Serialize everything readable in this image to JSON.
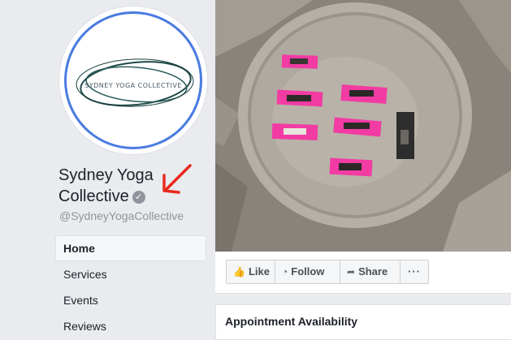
{
  "page": {
    "name": "Sydney Yoga Collective",
    "handle": "@SydneyYogaCollective",
    "verified_icon": "verified-check-icon",
    "logo_text": "SYDNEY YOGA COLLECTIVE"
  },
  "colors": {
    "avatar_ring": "#4a7be0",
    "arrow": "#e8291f",
    "mat": "#f23ba3",
    "page_bg": "#e9ebee"
  },
  "nav": {
    "items": [
      {
        "label": "Home",
        "active": true
      },
      {
        "label": "Services",
        "active": false
      },
      {
        "label": "Events",
        "active": false
      },
      {
        "label": "Reviews",
        "active": false
      }
    ]
  },
  "actions": {
    "like": {
      "label": "Like",
      "icon": "thumbs-up-icon"
    },
    "follow": {
      "label": "Follow",
      "icon": "rss-icon"
    },
    "share": {
      "label": "Share",
      "icon": "share-arrow-icon"
    },
    "more": {
      "label": "···",
      "icon": "more-dots-icon"
    }
  },
  "card": {
    "title": "Appointment Availability"
  }
}
